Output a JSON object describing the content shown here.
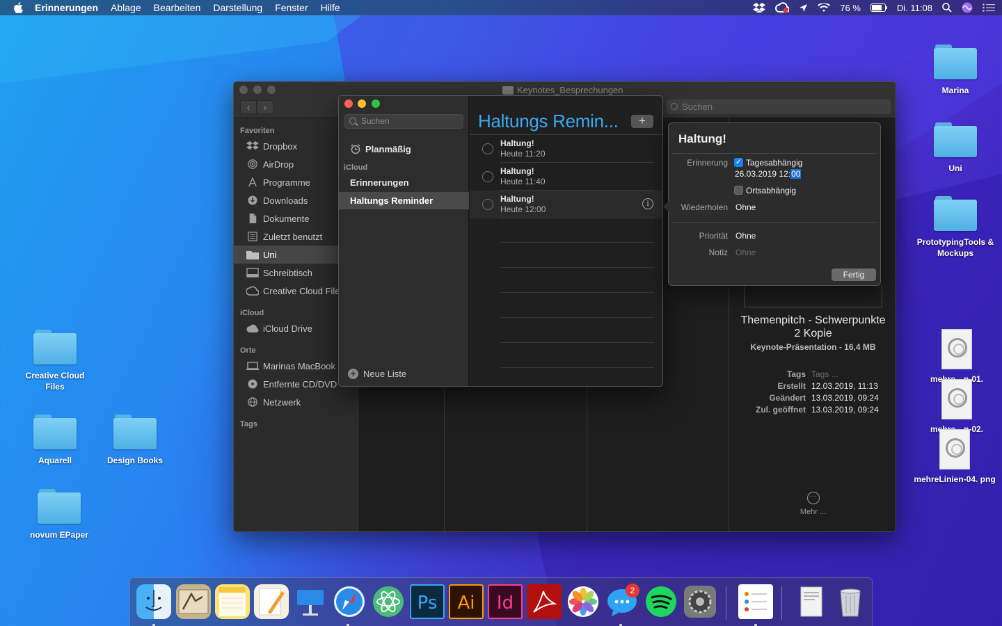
{
  "menubar": {
    "app": "Erinnerungen",
    "items": [
      "Ablage",
      "Bearbeiten",
      "Darstellung",
      "Fenster",
      "Hilfe"
    ],
    "battery": "76 %",
    "clock": "Di. 11:08"
  },
  "desktop": {
    "right_icons": [
      "Marina",
      "Uni",
      "PrototypingTools & Mockups"
    ],
    "png_files": [
      "mehre…n-01.",
      "mehre…n-02.",
      "mehreLinien-04. png"
    ],
    "left_icons": [
      "Creative Cloud Files",
      "Aquarell",
      "Design Books",
      "novum EPaper"
    ]
  },
  "finder": {
    "title": "Keynotes_Besprechungen",
    "search_placeholder": "Suchen",
    "favorites_header": "Favoriten",
    "favorites": [
      "Dropbox",
      "AirDrop",
      "Programme",
      "Downloads",
      "Dokumente",
      "Zuletzt benutzt",
      "Uni",
      "Schreibtisch",
      "Creative Cloud Files"
    ],
    "icloud_header": "iCloud",
    "icloud": [
      "iCloud Drive"
    ],
    "places_header": "Orte",
    "places": [
      "Marinas MacBook",
      "Entfernte CD/DVD",
      "Netzwerk"
    ],
    "tags_header": "Tags",
    "preview": {
      "title_line1": "Themenpitch - Schwerpunkte",
      "title_line2": "2 Kopie",
      "subtitle": "Keynote-Präsentation - 16,4 MB",
      "tags_label": "Tags",
      "tags_value": "Tags ...",
      "created_label": "Erstellt",
      "created_value": "12.03.2019, 11:13",
      "modified_label": "Geändert",
      "modified_value": "13.03.2019, 09:24",
      "opened_label": "Zul. geöffnet",
      "opened_value": "13.03.2019, 09:24",
      "more_label": "Mehr ..."
    }
  },
  "reminders": {
    "search_placeholder": "Suchen",
    "scheduled": "Planmäßig",
    "icloud_header": "iCloud",
    "lists": [
      "Erinnerungen",
      "Haltungs Reminder"
    ],
    "new_list": "Neue Liste",
    "list_title": "Haltungs Remin...",
    "add_button": "+",
    "tasks": [
      {
        "title": "Haltung!",
        "time": "Heute 11:20"
      },
      {
        "title": "Haltung!",
        "time": "Heute 11:40"
      },
      {
        "title": "Haltung!",
        "time": "Heute 12:00"
      }
    ]
  },
  "popover": {
    "title": "Haltung!",
    "reminder_label": "Erinnerung",
    "day_based": "Tagesabhängig",
    "date": "26.03.2019 12:",
    "date_selected": "00",
    "location_based": "Ortsabhängig",
    "repeat_label": "Wiederholen",
    "repeat_value": "Ohne",
    "priority_label": "Priorität",
    "priority_value": "Ohne",
    "note_label": "Notiz",
    "note_placeholder": "Ohne",
    "done_button": "Fertig"
  },
  "dock": {
    "badge_messages": "2",
    "label_ps": "Ps",
    "label_ai": "Ai",
    "label_id": "Id"
  }
}
